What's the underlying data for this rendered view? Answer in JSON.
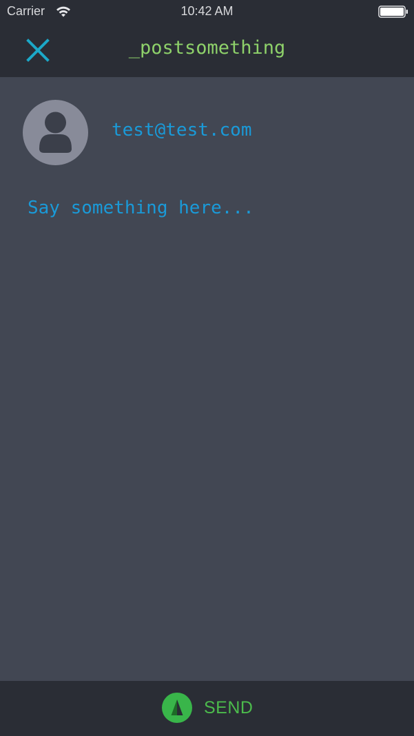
{
  "status_bar": {
    "carrier": "Carrier",
    "time": "10:42 AM",
    "wifi_icon": "wifi-icon",
    "battery_icon": "battery-full-icon"
  },
  "nav": {
    "title": "_postsomething",
    "close_icon": "close-icon"
  },
  "composer": {
    "user_email": "test@test.com",
    "avatar_icon": "person-icon",
    "placeholder": "Say something here...",
    "value": ""
  },
  "footer": {
    "send_label": "SEND",
    "send_icon": "send-arrow-icon"
  },
  "colors": {
    "background": "#424753",
    "bar_background": "#2a2d35",
    "accent_blue": "#1a9ad8",
    "accent_green": "#8ed16a",
    "send_green": "#4cbb4c",
    "close_cyan": "#1ba8c8",
    "avatar_gray": "#888b99"
  }
}
